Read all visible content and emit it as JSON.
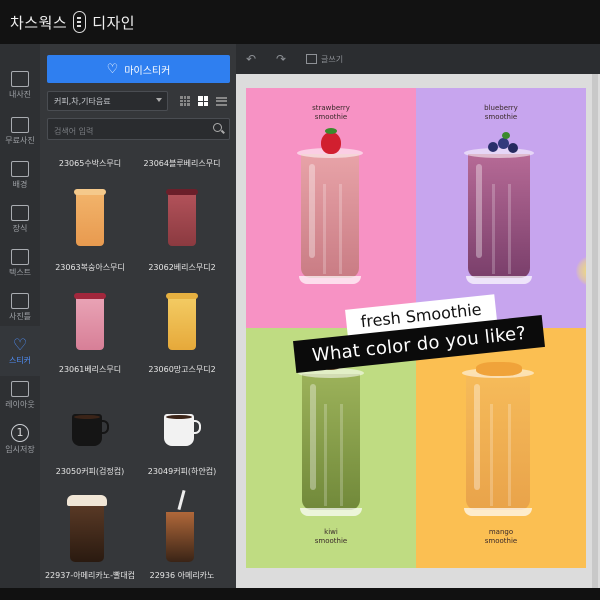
{
  "app": {
    "title": "차스웍스",
    "title_suffix": "디자인"
  },
  "rail": [
    {
      "label": "내사진",
      "icon": "camera-icon"
    },
    {
      "label": "무료사진",
      "icon": "free-photo-icon"
    },
    {
      "label": "배경",
      "icon": "background-icon"
    },
    {
      "label": "장식",
      "icon": "decoration-icon"
    },
    {
      "label": "텍스트",
      "icon": "text-icon"
    },
    {
      "label": "사진틀",
      "icon": "frame-icon"
    },
    {
      "label": "스티커",
      "icon": "heart-sticker-icon"
    },
    {
      "label": "레이아웃",
      "icon": "layout-icon"
    },
    {
      "label": "임시저장",
      "icon": "save-number-icon",
      "badge": "1"
    }
  ],
  "panel": {
    "my_sticker_label": "마이스티커",
    "category_value": "커피,차,기타음료",
    "search_placeholder": "검색어 입력",
    "stickers": [
      {
        "label": "23065수박스무디"
      },
      {
        "label": "23064블루베리스무디"
      },
      {
        "label": "23063복숭아스무디"
      },
      {
        "label": "23062베리스무디2"
      },
      {
        "label": "23061베리스무디"
      },
      {
        "label": "23060망고스무디2"
      },
      {
        "label": "23050커피(검정컵)"
      },
      {
        "label": "23049커피(하얀컵)"
      },
      {
        "label": "22937-아메리카노-빨대컵"
      },
      {
        "label": "22936 아메리카노"
      }
    ]
  },
  "toolbar": {
    "undo": "↶",
    "redo": "↷",
    "text_label": "글쓰기"
  },
  "design": {
    "quadrants": [
      {
        "label": "strawberry\nsmoothie",
        "bg": "#f792c4",
        "drink": "#d88a92"
      },
      {
        "label": "blueberry\nsmoothie",
        "bg": "#c7a5ee",
        "drink": "#9c5f86"
      },
      {
        "label": "kiwi\nsmoothie",
        "bg": "#bfdc82",
        "drink": "#7f9a46"
      },
      {
        "label": "mango\nsmoothie",
        "bg": "#fbbf52",
        "drink": "#f0aa4a"
      }
    ],
    "banner_small": "fresh Smoothie",
    "banner_large": "What color do you like?"
  },
  "colors": {
    "accent": "#2f7ff0",
    "panel_bg": "#35373a",
    "rail_bg": "#2e3033"
  }
}
